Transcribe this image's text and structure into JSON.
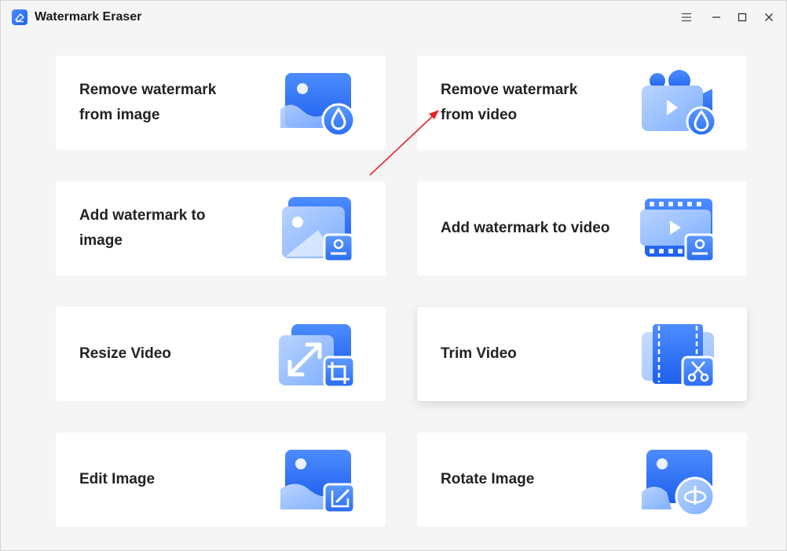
{
  "app": {
    "title": "Watermark Eraser"
  },
  "window_controls": {
    "menu_icon": "menu-icon",
    "minimize_icon": "minimize-icon",
    "maximize_icon": "maximize-icon",
    "close_icon": "close-icon"
  },
  "colors": {
    "accent": "#2f74ff",
    "accent_light": "#8db8ff",
    "card_bg": "#ffffff",
    "page_bg": "#f5f5f5",
    "annotation_arrow": "#e8232a"
  },
  "cards": [
    {
      "label": "Remove watermark from image",
      "icon": "image-drop-icon"
    },
    {
      "label": "Remove watermark from video",
      "icon": "video-drop-icon"
    },
    {
      "label": "Add watermark to image",
      "icon": "image-stamp-icon"
    },
    {
      "label": "Add watermark to video",
      "icon": "video-stamp-icon"
    },
    {
      "label": "Resize Video",
      "icon": "resize-crop-icon"
    },
    {
      "label": "Trim Video",
      "icon": "trim-scissors-icon"
    },
    {
      "label": "Edit Image",
      "icon": "image-edit-icon"
    },
    {
      "label": "Rotate Image",
      "icon": "image-rotate-icon"
    }
  ]
}
